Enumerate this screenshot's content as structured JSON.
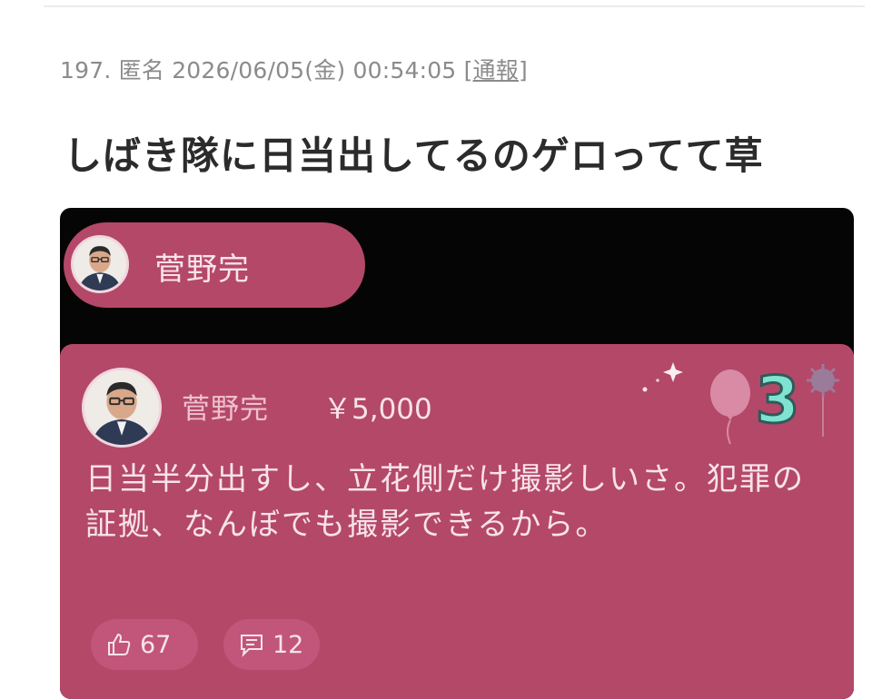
{
  "post": {
    "number": "197.",
    "author": "匿名",
    "datetime": "2026/06/05(金) 00:54:05",
    "report_open": "[",
    "report_label": "通報",
    "report_close": "]",
    "body": "しばき隊に日当出してるのゲロってて草"
  },
  "embedded_screenshot": {
    "sender_pill": {
      "name": "菅野完"
    },
    "superchat": {
      "name": "菅野完",
      "amount": "￥5,000",
      "badge_number": "3",
      "message": "日当半分出すし、立花側だけ撮影しいさ。犯罪の証拠、なんぼでも撮影できるから。",
      "like_count": "67",
      "comment_count": "12"
    },
    "colors": {
      "card": "#b44869",
      "frame": "#050505",
      "badge": "#7fe3d1"
    }
  }
}
